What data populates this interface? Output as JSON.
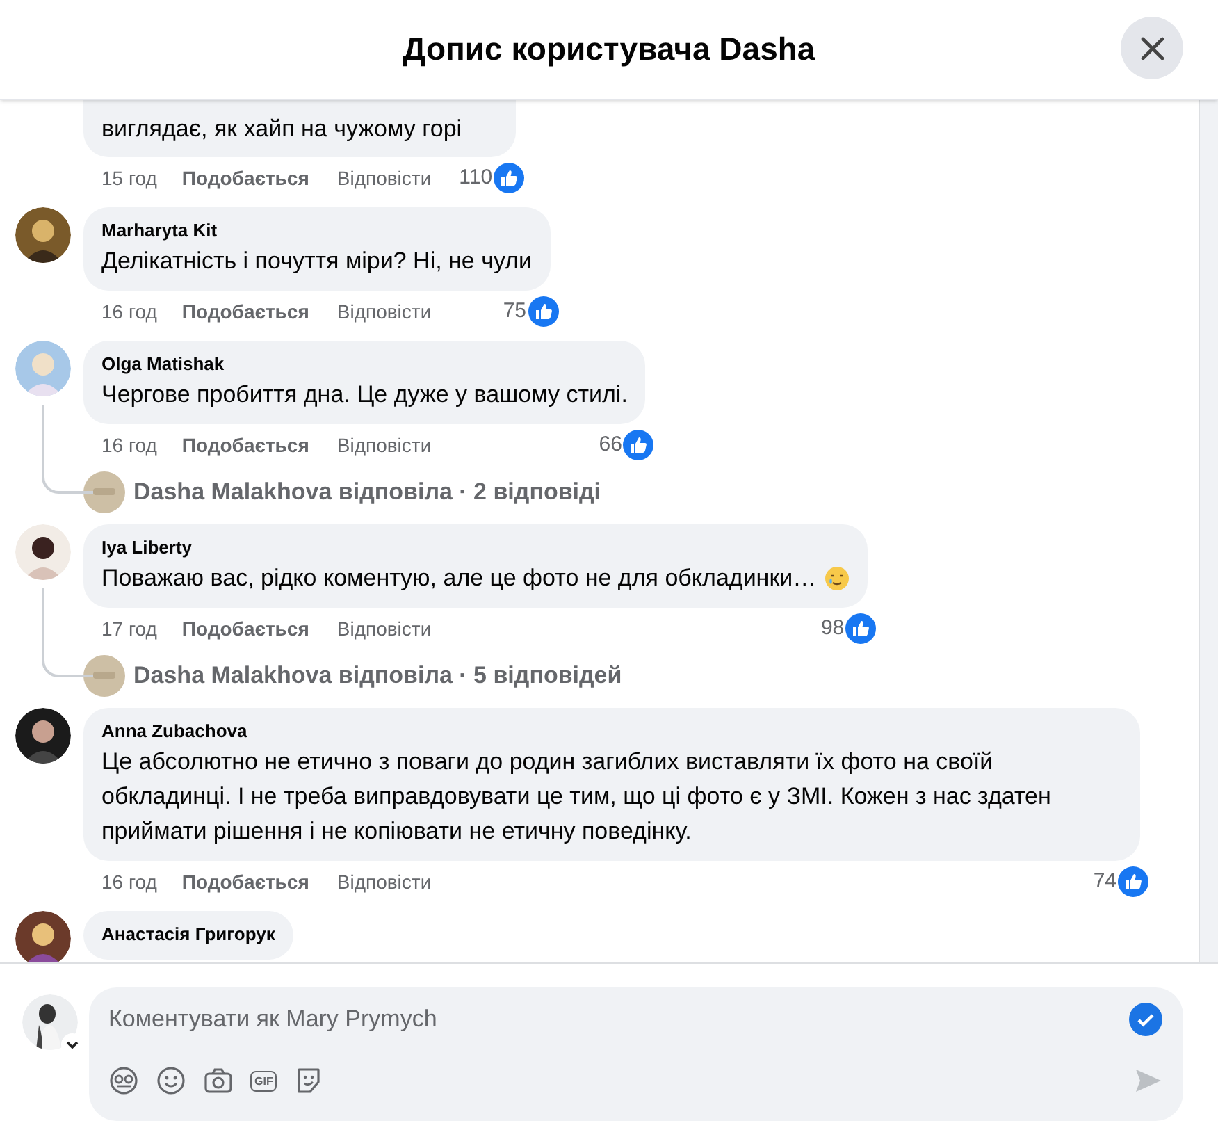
{
  "header": {
    "title": "Допис користувача Dasha"
  },
  "comments": [
    {
      "text": "виглядає, як хайп на чужому горі",
      "time": "15 год",
      "like": "Подобається",
      "reply": "Відповісти",
      "likes": "110",
      "cut_top": true
    },
    {
      "author": "Marharyta Kit",
      "text": "Делікатність і почуття міри? Ні, не чули",
      "time": "16 год",
      "like": "Подобається",
      "reply": "Відповісти",
      "likes": "75"
    },
    {
      "author": "Olga Matishak",
      "text": "Чергове пробиття дна. Це дуже у вашому стилі.",
      "time": "16 год",
      "like": "Подобається",
      "reply": "Відповісти",
      "likes": "66",
      "replies": "Dasha Malakhova відповіла · 2 відповіді"
    },
    {
      "author": "Iya Liberty",
      "text": "Поважаю вас, рідко коментую, але це фото не для обкладинки…",
      "emoji": true,
      "time": "17 год",
      "like": "Подобається",
      "reply": "Відповісти",
      "likes": "98",
      "replies": "Dasha Malakhova відповіла · 5 відповідей"
    },
    {
      "author": "Anna Zubachova",
      "text": "Це абсолютно не етично з поваги до родин загиблих виставляти їх фото на своїй обкладинці. І не треба виправдовувати це тим, що ці фото є у ЗМІ. Кожен з нас здатен приймати рішення і не копіювати не етичну поведінку.",
      "time": "16 год",
      "like": "Подобається",
      "reply": "Відповісти",
      "likes": "74"
    },
    {
      "author": "Анастасія Григорук",
      "cut_bottom": true
    }
  ],
  "composer": {
    "placeholder": "Коментувати як Mary Prymych",
    "gif_label": "GIF"
  }
}
